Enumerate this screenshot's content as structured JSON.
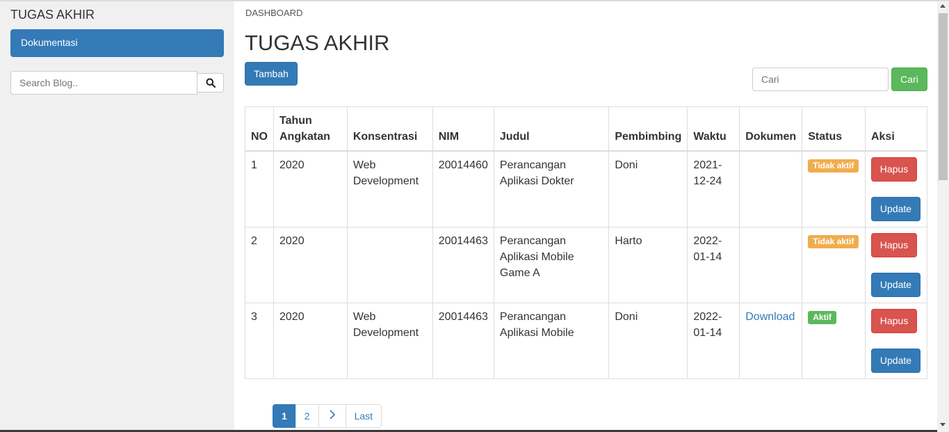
{
  "sidebar": {
    "brand": "TUGAS AKHIR",
    "nav_items": [
      {
        "label": "Dokumentasi"
      }
    ],
    "search": {
      "placeholder": "Search Blog.."
    }
  },
  "main": {
    "breadcrumb": "DASHBOARD",
    "title": "TUGAS AKHIR",
    "add_button": "Tambah",
    "search": {
      "placeholder": "Cari",
      "button": "Cari"
    },
    "table": {
      "headers": [
        "NO",
        "Tahun Angkatan",
        "Konsentrasi",
        "NIM",
        "Judul",
        "Pembimbing",
        "Waktu",
        "Dokumen",
        "Status",
        "Aksi"
      ],
      "rows": [
        {
          "no": "1",
          "tahun": "2020",
          "konsentrasi": "Web Development",
          "nim": "20014460",
          "judul": "Perancangan Aplikasi Dokter",
          "pembimbing": "Doni",
          "waktu": "2021-12-24",
          "dokumen": "",
          "status": "Tidak aktif",
          "hapus": "Hapus",
          "update": "Update"
        },
        {
          "no": "2",
          "tahun": "2020",
          "konsentrasi": "",
          "nim": "20014463",
          "judul": "Perancangan Aplikasi Mobile Game A",
          "pembimbing": "Harto",
          "waktu": "2022-01-14",
          "dokumen": "",
          "status": "Tidak aktif",
          "hapus": "Hapus",
          "update": "Update"
        },
        {
          "no": "3",
          "tahun": "2020",
          "konsentrasi": "Web Development",
          "nim": "20014463",
          "judul": "Perancangan Aplikasi Mobile",
          "pembimbing": "Doni",
          "waktu": "2022-01-14",
          "dokumen": "Download",
          "status": "Aktif",
          "hapus": "Hapus",
          "update": "Update"
        }
      ]
    },
    "pagination": {
      "pages": [
        "1",
        "2"
      ],
      "active": "1",
      "last": "Last"
    }
  },
  "colors": {
    "primary": "#337ab7",
    "danger": "#d9534f",
    "success": "#5cb85c",
    "warning": "#f0ad4e",
    "sidebar_bg": "#f0f0f0"
  },
  "icons": {
    "search": "search-icon",
    "next": "chevron-right-icon"
  }
}
